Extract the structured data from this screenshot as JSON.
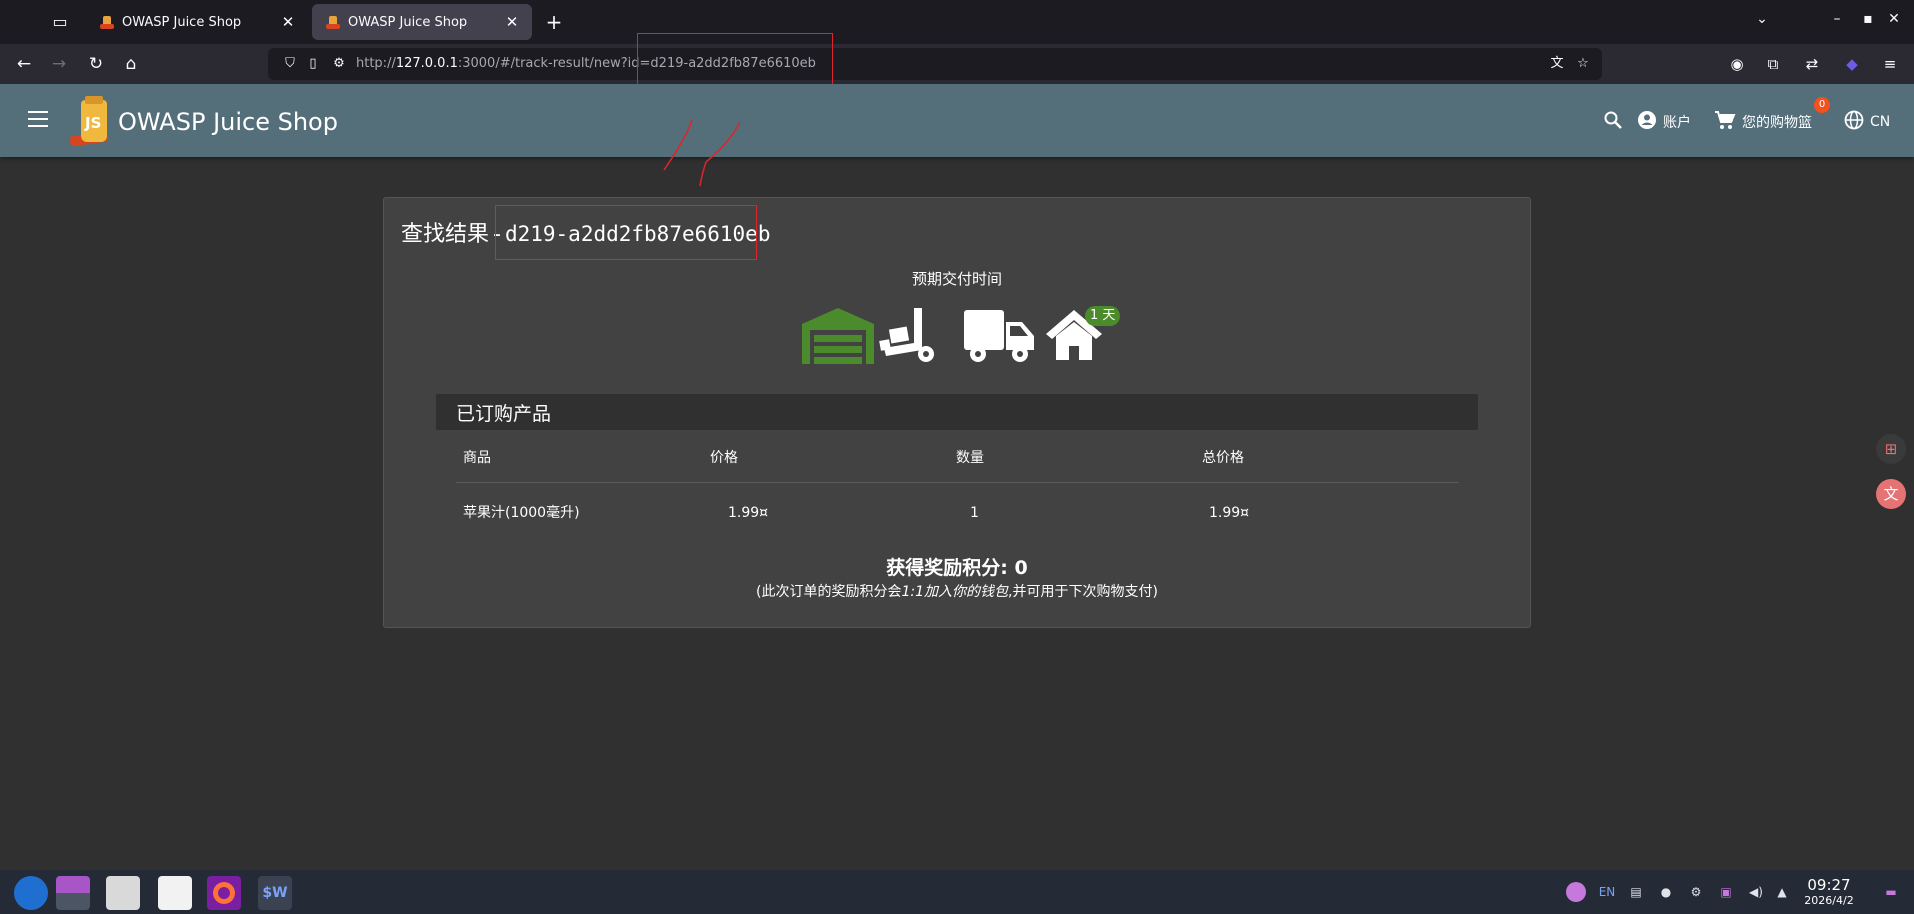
{
  "browser": {
    "tabs": [
      {
        "title": "OWASP Juice Shop",
        "active": false
      },
      {
        "title": "OWASP Juice Shop",
        "active": true
      }
    ],
    "url_prefix": "http://",
    "url_host": "127.0.0.1",
    "url_rest": ":3000/#/track-result/new?id=d219-a2dd2fb87e6610eb"
  },
  "app": {
    "title": "OWASP Juice Shop",
    "account_label": "账户",
    "basket_label": "您的购物篮",
    "basket_count": "0",
    "language_label": "CN",
    "accent_color": "#546e7a"
  },
  "track": {
    "heading": "查找结果",
    "separator": "-",
    "order_id": "d219-a2dd2fb87e6610eb",
    "eta_label": "预期交付时间",
    "eta_badge": "1 天",
    "stage_icons": [
      "warehouse-icon",
      "dolly-icon",
      "truck-icon",
      "home-icon"
    ],
    "stage_color_done": "#4b8b2b",
    "ordered_title": "已订购产品",
    "columns": [
      "商品",
      "价格",
      "数量",
      "总价格"
    ],
    "rows": [
      {
        "product": "苹果汁(1000毫升)",
        "price": "1.99¤",
        "quantity": "1",
        "total": "1.99¤"
      }
    ],
    "bonus_label": "获得奖励积分: 0",
    "bonus_note_start": "(此次订单的奖励积分会",
    "bonus_note_em": "1:1加入你的钱包",
    "bonus_note_end": ",并可用于下次购物支付)"
  },
  "taskbar": {
    "lang": "EN",
    "time": "09:27",
    "date": "2026/4/2"
  }
}
